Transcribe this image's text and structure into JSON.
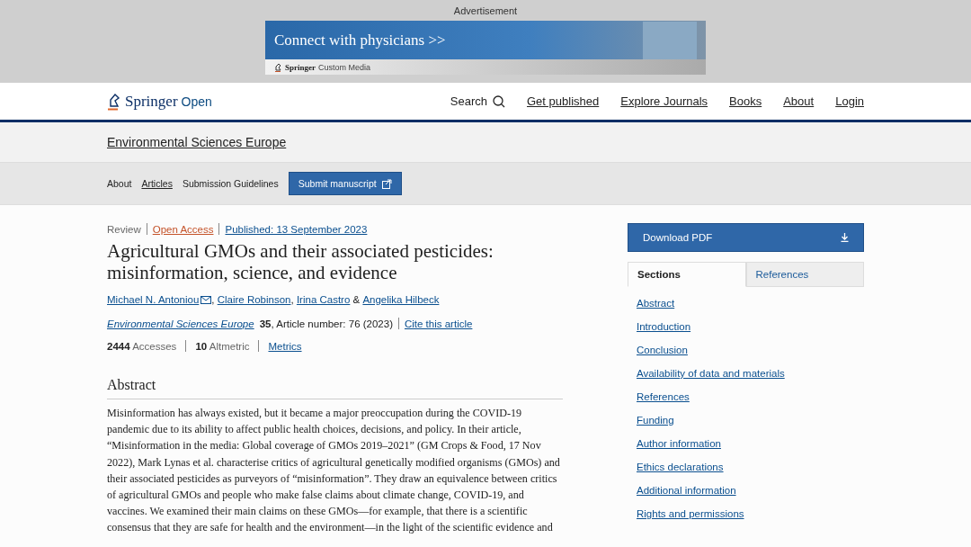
{
  "advertisement": {
    "label": "Advertisement",
    "headline": "Connect with physicians >>",
    "sponsor_brand": "Springer",
    "sponsor_unit": "Custom Media"
  },
  "header": {
    "logo_brand": "Springer",
    "logo_suffix": "Open",
    "search": "Search",
    "links": [
      "Get published",
      "Explore Journals",
      "Books",
      "About",
      "Login"
    ]
  },
  "journal": {
    "title": "Environmental Sciences Europe"
  },
  "journal_nav": {
    "links": [
      {
        "label": "About",
        "selected": false
      },
      {
        "label": "Articles",
        "selected": true
      },
      {
        "label": "Submission Guidelines",
        "selected": false
      }
    ],
    "submit": "Submit manuscript"
  },
  "article": {
    "type": "Review",
    "access": "Open Access",
    "published": "Published: 13 September 2023",
    "title": "Agricultural GMOs and their associated pesticides: misinformation, science, and evidence",
    "authors": [
      {
        "name": "Michael N. Antoniou",
        "corresponding": true
      },
      {
        "name": "Claire Robinson",
        "corresponding": false
      },
      {
        "name": "Irina Castro",
        "corresponding": false
      },
      {
        "name": "Angelika Hilbeck",
        "corresponding": false
      }
    ],
    "author_separators": [
      ", ",
      ", ",
      " & "
    ],
    "journal_link": "Environmental Sciences Europe",
    "volume": "35",
    "article_number": ", Article number: 76 (2023)",
    "cite": "Cite this article",
    "metrics": [
      "**2444** Accesses",
      "**10** Altmetric"
    ],
    "metrics_link": "Metrics",
    "abstract_heading": "Abstract",
    "abstract": "Misinformation has always existed, but it became a major preoccupation during the COVID-19 pandemic due to its ability to affect public health choices, decisions, and policy. In their article, “Misinformation in the media: Global coverage of GMOs 2019–2021” (GM Crops & Food, 17 Nov 2022), Mark Lynas et al. characterise critics of agricultural genetically modified organisms (GMOs) and their associated pesticides as purveyors of “misinformation”. They draw an equivalence between critics of agricultural GMOs and people who make false claims about climate change, COVID-19, and vaccines. We examined their main claims on these GMOs—for example, that there is a scientific consensus that they are safe for health and the environment—in the light of the scientific evidence and"
  },
  "sidebar": {
    "download": "Download PDF",
    "tabs": [
      {
        "label": "Sections",
        "selected": true
      },
      {
        "label": "References",
        "selected": false
      }
    ],
    "sections": [
      "Abstract",
      "Introduction",
      "Conclusion",
      "Availability of data and materials",
      "References",
      "Funding",
      "Author information",
      "Ethics declarations",
      "Additional information",
      "Rights and permissions"
    ]
  }
}
